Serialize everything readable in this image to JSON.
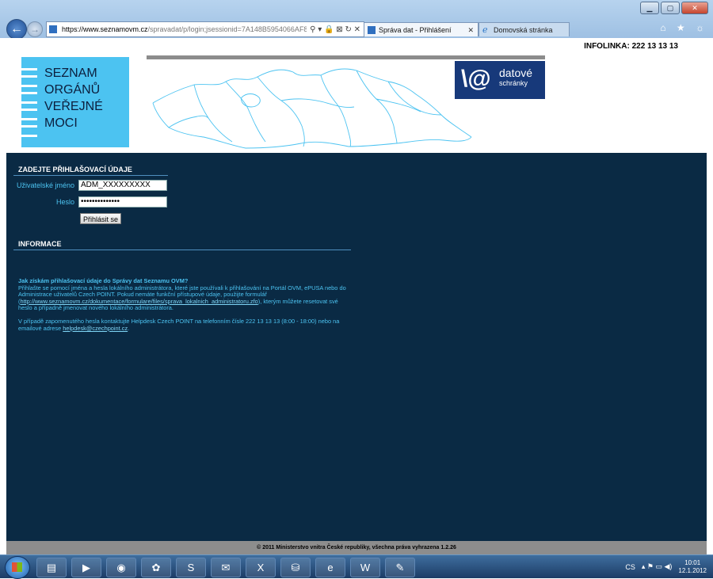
{
  "browser": {
    "url_host": "https://www.seznamovm.cz",
    "url_path": "/spravadat/p/login;jsessionid=7A148B5954066AF83BB8",
    "address_icons": "⚲ ▾ 🔒 ⊠ ↻ ✕",
    "tabs": [
      {
        "label": "Správa dat - Přihlášení",
        "active": true
      },
      {
        "label": "Domovská stránka",
        "active": false
      }
    ],
    "right_icons": "⌂ ★ ☼"
  },
  "header": {
    "infolinka": "INFOLINKA: 222 13 13 13",
    "logo_lines": [
      "SEZNAM",
      "ORGÁNŮ",
      "VEŘEJNÉ",
      "MOCI"
    ],
    "ds_logo": {
      "mark": "\\@",
      "line1": "datové",
      "line2": "schránky"
    }
  },
  "login": {
    "heading": "ZADEJTE PŘIHLAŠOVACÍ ÚDAJE",
    "username_label": "Uživatelské jméno",
    "username_value": "ADM_XXXXXXXXX",
    "password_label": "Heslo",
    "password_value": "••••••••••••••",
    "submit_label": "Přihlásit se"
  },
  "info": {
    "heading": "INFORMACE",
    "question": "Jak získám přihlašovací údaje do Správy dat Seznamu OVM?",
    "para1_a": "Přihlašte se pomocí jména a hesla lokálního administrátora, které jste používali k přihlašování na Portál OVM, ePUSA nebo do Administrace uživatelů Czech POINT. Pokud nemáte funkční přístupové údaje, použijte formulář (",
    "para1_link": "http://www.seznamovm.cz/dokumentace/formulare/files/sprava_lokalnich_administratoru.zfo",
    "para1_b": "), kterým můžete resetovat své heslo a případně jmenovat nového lokálního administrátora.",
    "para2_a": "V případě zapomenutého hesla kontaktujte Helpdesk Czech POINT na telefonním čísle 222 13 13 13 (8:00 - 18:00) nebo na emailové adrese ",
    "para2_link": "helpdesk@czechpoint.cz",
    "para2_b": "."
  },
  "footer": {
    "text": "© 2011 Ministerstvo vnitra České republiky, všechna práva vyhrazena   1.2.26"
  },
  "taskbar": {
    "apps": [
      {
        "icon": "folder-icon",
        "glyph": "▤"
      },
      {
        "icon": "media-player-icon",
        "glyph": "▶"
      },
      {
        "icon": "firefox-icon",
        "glyph": "◉"
      },
      {
        "icon": "icq-icon",
        "glyph": "✿"
      },
      {
        "icon": "skype-icon",
        "glyph": "S"
      },
      {
        "icon": "outlook-icon",
        "glyph": "✉"
      },
      {
        "icon": "excel-icon",
        "glyph": "X"
      },
      {
        "icon": "network-icon",
        "glyph": "⛁"
      },
      {
        "icon": "ie-icon",
        "glyph": "e"
      },
      {
        "icon": "word-icon",
        "glyph": "W"
      },
      {
        "icon": "paint-icon",
        "glyph": "✎"
      }
    ],
    "language": "CS",
    "tray_icons": "▴ ⚑ ▭ ◀)",
    "time": "10:01",
    "date": "12.1.2012"
  },
  "colors": {
    "page_bg": "#0a2a44",
    "accent_cyan": "#4cc3f1",
    "logo_navy": "#17397a",
    "footer_gray": "#8d8d8d"
  }
}
